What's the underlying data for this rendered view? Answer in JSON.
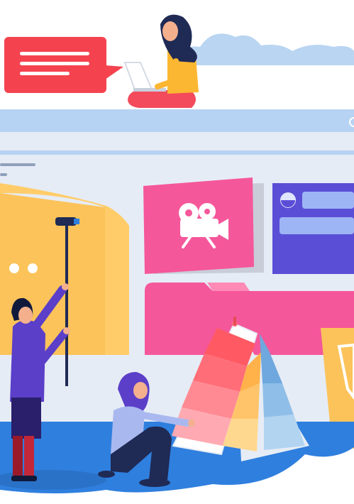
{
  "colors": {
    "background": "#ffffff",
    "browser_frame": "#e6ecf5",
    "browser_bar": "#b7d3f3",
    "cloud": "#b9d5f2",
    "floor": "#2f7fde",
    "speech_bubble": "#f4434f",
    "poster": "#fbc35a",
    "video_card": "#f5579b",
    "profile_card": "#5b4ed6",
    "folder": "#f5579b",
    "swatch_red": "#ff5a64",
    "swatch_orange": "#ffb24a",
    "swatch_blue": "#8fbfe8",
    "figure_purple": "#5b3fc8",
    "figure_navy": "#1f2a55"
  },
  "icons": {
    "speech_bubble": "message-icon",
    "video": "video-camera-icon",
    "avatar": "user-avatar-icon"
  }
}
